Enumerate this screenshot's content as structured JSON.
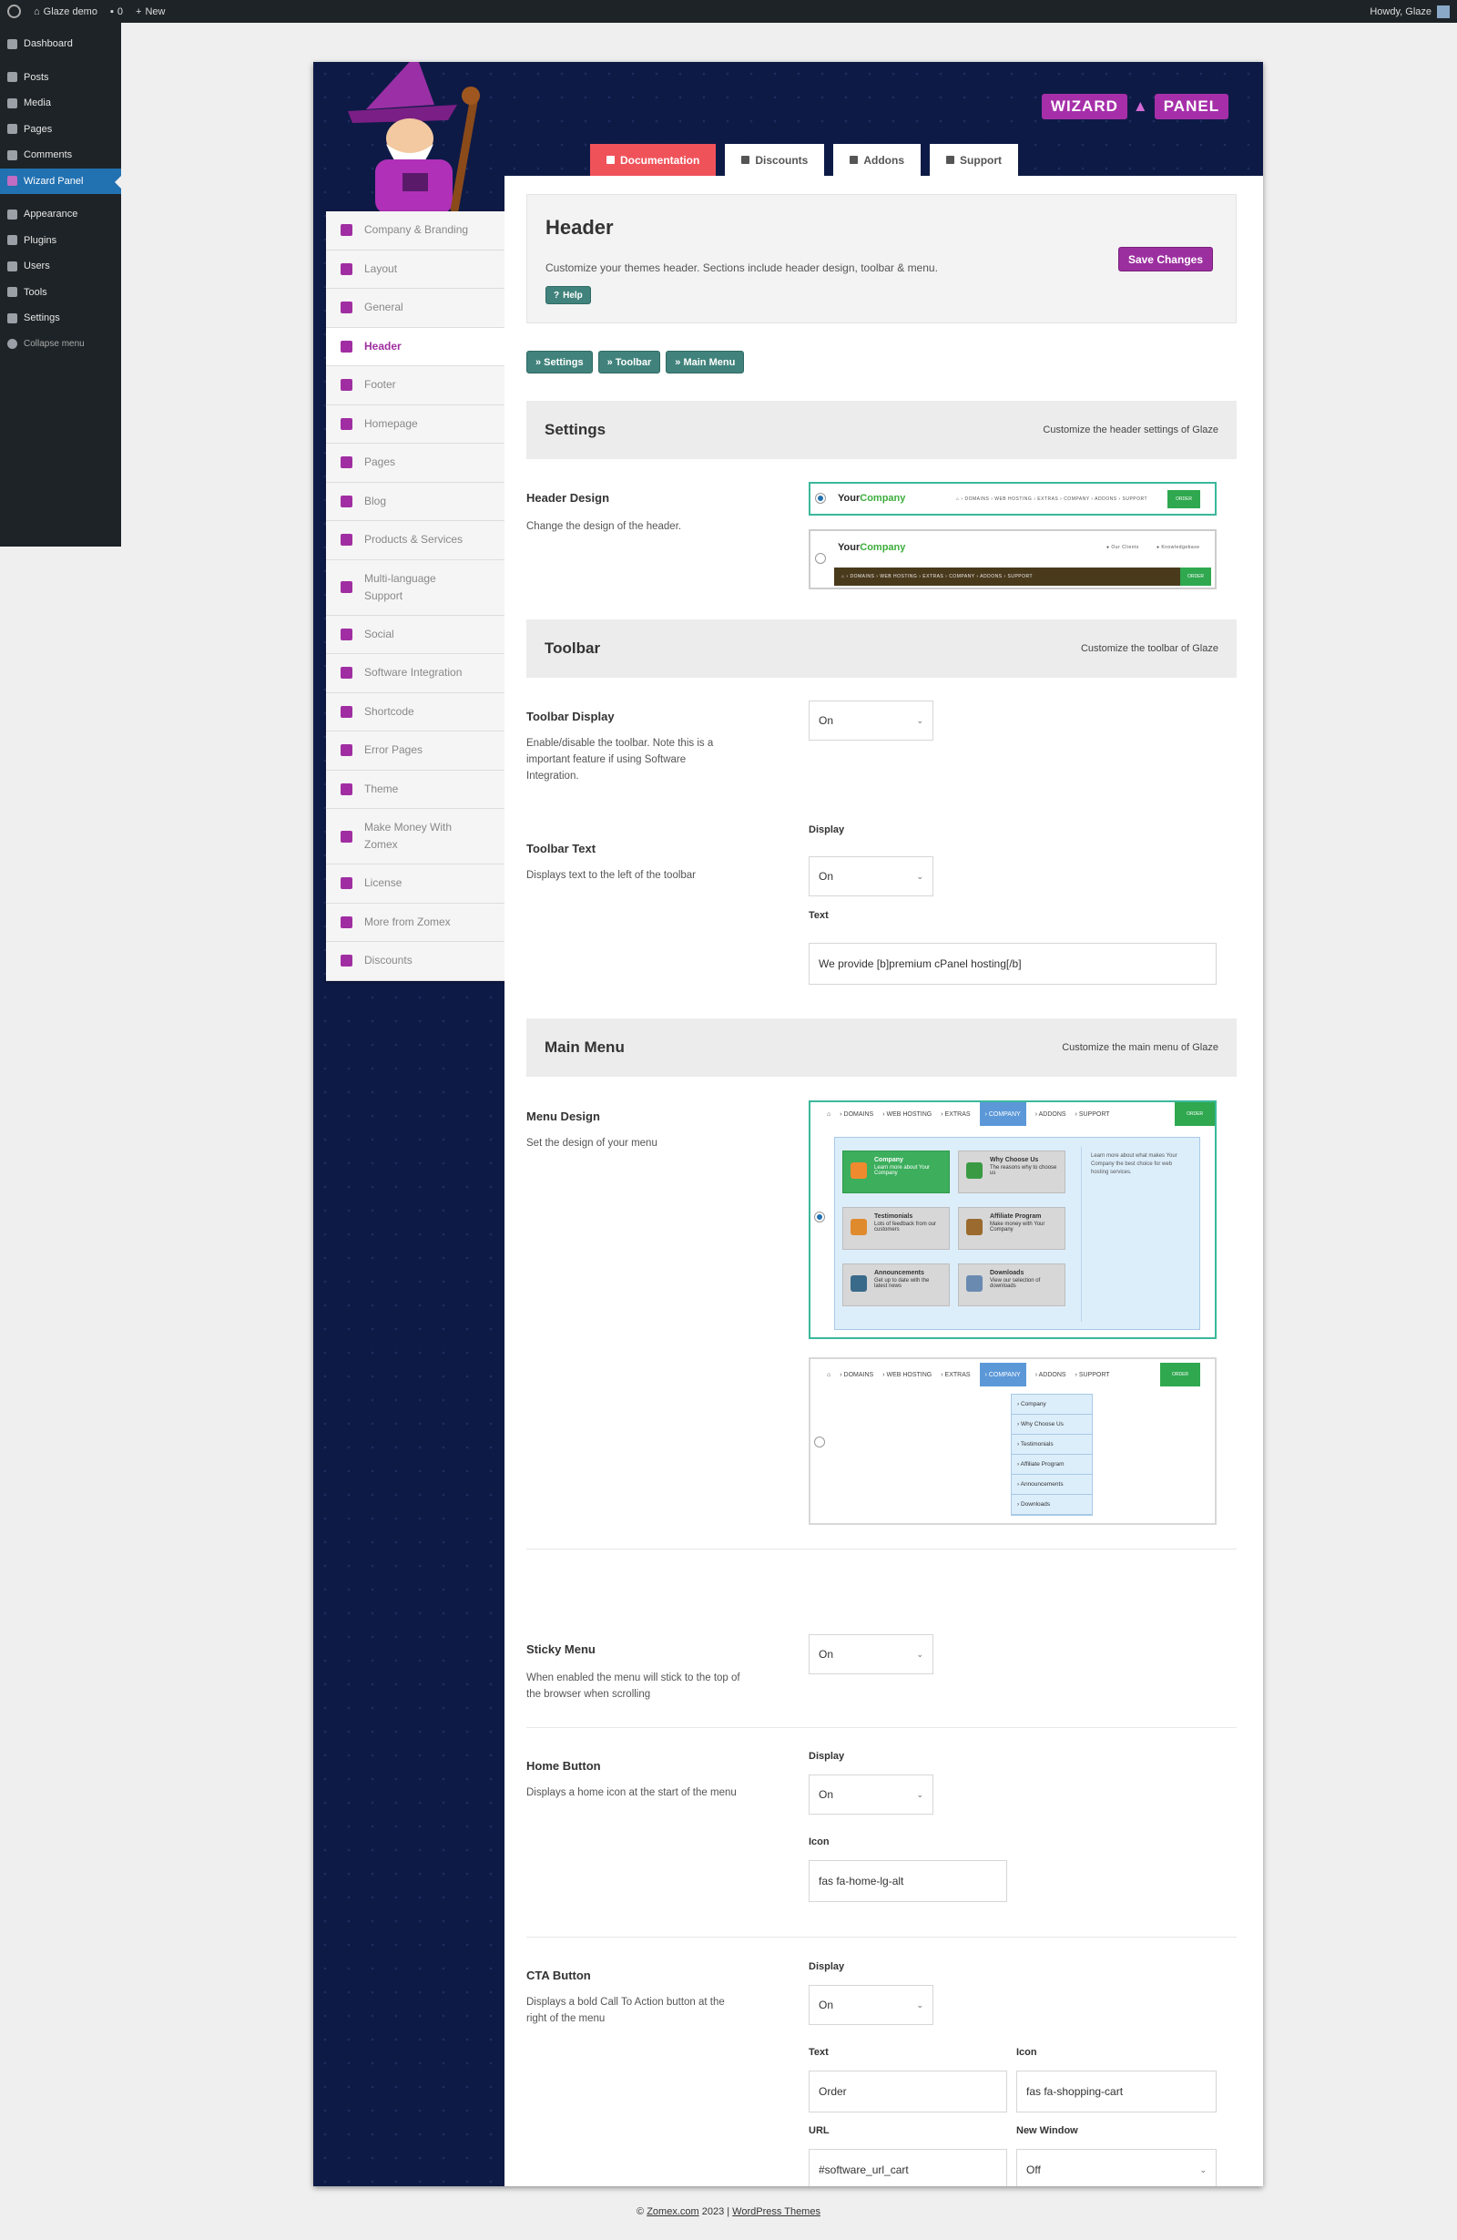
{
  "adminbar": {
    "site_name": "Glaze demo",
    "comments_count": "0",
    "new_label": "New",
    "howdy": "Howdy, Glaze"
  },
  "wpmenu": {
    "items": [
      {
        "label": "Dashboard",
        "icon": "dashboard-icon"
      },
      {
        "label": "Posts",
        "icon": "pin-icon"
      },
      {
        "label": "Media",
        "icon": "media-icon"
      },
      {
        "label": "Pages",
        "icon": "page-icon"
      },
      {
        "label": "Comments",
        "icon": "comment-icon"
      },
      {
        "label": "Wizard Panel",
        "icon": "wizard-icon",
        "active": true
      },
      {
        "label": "Appearance",
        "icon": "brush-icon"
      },
      {
        "label": "Plugins",
        "icon": "plugin-icon"
      },
      {
        "label": "Users",
        "icon": "users-icon"
      },
      {
        "label": "Tools",
        "icon": "wrench-icon"
      },
      {
        "label": "Settings",
        "icon": "settings-icon"
      }
    ],
    "collapse_label": "Collapse menu"
  },
  "logo": {
    "left": "WIZARD",
    "right": "PANEL"
  },
  "top_tabs": [
    {
      "label": "Documentation",
      "icon": "document-icon"
    },
    {
      "label": "Discounts",
      "icon": "tag-icon"
    },
    {
      "label": "Addons",
      "icon": "cart-icon"
    },
    {
      "label": "Support",
      "icon": "envelope-icon"
    }
  ],
  "sidenav": [
    {
      "label": "Company & Branding"
    },
    {
      "label": "Layout"
    },
    {
      "label": "General"
    },
    {
      "label": "Header",
      "active": true
    },
    {
      "label": "Footer"
    },
    {
      "label": "Homepage"
    },
    {
      "label": "Pages"
    },
    {
      "label": "Blog"
    },
    {
      "label": "Products & Services"
    },
    {
      "label": "Multi-language Support",
      "tall": true
    },
    {
      "label": "Social"
    },
    {
      "label": "Software Integration"
    },
    {
      "label": "Shortcode"
    },
    {
      "label": "Error Pages"
    },
    {
      "label": "Theme"
    },
    {
      "label": "Make Money With Zomex",
      "tall": true
    },
    {
      "label": "License"
    },
    {
      "label": "More from Zomex"
    },
    {
      "label": "Discounts"
    }
  ],
  "intro": {
    "title": "Header",
    "description": "Customize your themes header. Sections include header design, toolbar & menu.",
    "help_label": "Help",
    "save_label": "Save Changes"
  },
  "quicklinks": [
    "» Settings",
    "» Toolbar",
    "» Main Menu"
  ],
  "sections": {
    "settings": {
      "title": "Settings",
      "subtitle": "Customize the header settings of Glaze"
    },
    "toolbar": {
      "title": "Toolbar",
      "subtitle": "Customize the toolbar of Glaze"
    },
    "main_menu": {
      "title": "Main Menu",
      "subtitle": "Customize the main menu of Glaze"
    }
  },
  "header_design": {
    "label": "Header Design",
    "desc": "Change the design of the header.",
    "preview_brand_a": "Your",
    "preview_brand_b": "Company",
    "preview_menu": "⌂ › DOMAINS › WEB HOSTING › EXTRAS › COMPANY › ADDONS › SUPPORT",
    "preview_order": "ORDER",
    "preview_client": "● Our Clients",
    "preview_kb": "● Knowledgebase"
  },
  "toolbar_display": {
    "label": "Toolbar Display",
    "desc": "Enable/disable the toolbar. Note this is a important feature if using Software Integration.",
    "value": "On"
  },
  "toolbar_text": {
    "label": "Toolbar Text",
    "desc": "Displays text to the left of the toolbar",
    "display_label": "Display",
    "display_value": "On",
    "text_label": "Text",
    "text_value": "We provide [b]premium cPanel hosting[/b]"
  },
  "menu_design": {
    "label": "Menu Design",
    "desc": "Set the design of your menu",
    "bar_items": [
      "⌂",
      "› DOMAINS",
      "› WEB HOSTING",
      "› EXTRAS"
    ],
    "bar_active": "› COMPANY",
    "bar_after": [
      "› ADDONS",
      "› SUPPORT"
    ],
    "order": "ORDER",
    "cards": [
      {
        "title": "Company",
        "text": "Learn more about Your Company"
      },
      {
        "title": "Why Choose Us",
        "text": "The reasons why to choose us"
      },
      {
        "title": "Testimonials",
        "text": "Lots of feedback from our customers"
      },
      {
        "title": "Affiliate Program",
        "text": "Make money with Your Company"
      },
      {
        "title": "Announcements",
        "text": "Get up to date with the latest news"
      },
      {
        "title": "Downloads",
        "text": "View our selection of downloads"
      }
    ],
    "mega_side_text": "Learn more about what makes Your Company the best choice for web hosting services.",
    "dropdown": [
      "› Company",
      "› Why Choose Us",
      "› Testimonials",
      "› Affiliate Program",
      "› Announcements",
      "› Downloads"
    ]
  },
  "sticky_menu": {
    "label": "Sticky Menu",
    "desc": "When enabled the menu will stick to the top of the browser when scrolling",
    "value": "On"
  },
  "home_button": {
    "label": "Home Button",
    "desc": "Displays a home icon at the start of the menu",
    "display_label": "Display",
    "display_value": "On",
    "icon_label": "Icon",
    "icon_value": "fas fa-home-lg-alt"
  },
  "cta_button": {
    "label": "CTA Button",
    "desc": "Displays a bold Call To Action button at the right of the menu",
    "display_label": "Display",
    "display_value": "On",
    "text_label": "Text",
    "text_value": "Order",
    "icon_label": "Icon",
    "icon_value": "fas fa-shopping-cart",
    "url_label": "URL",
    "url_value": "#software_url_cart",
    "newwin_label": "New Window",
    "newwin_value": "Off"
  },
  "footer": {
    "copyright_prefix": "© ",
    "link1": "Zomex.com",
    "middle": " 2023 | ",
    "link2": "WordPress Themes"
  },
  "colors": {
    "accent": "#a02ea2",
    "teal": "#41837c",
    "panel_bg": "#0e1a46",
    "doc_tab": "#f0525a"
  }
}
